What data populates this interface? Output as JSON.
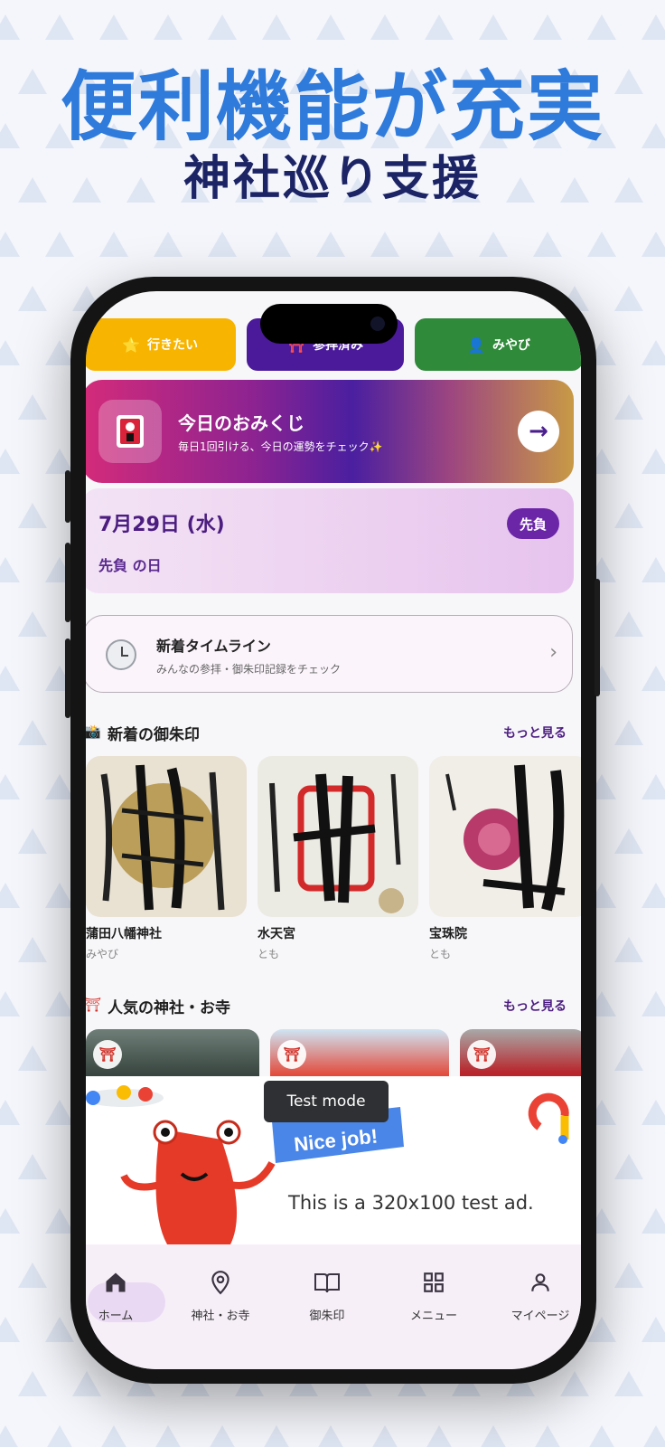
{
  "headline": "便利機能が充実",
  "subheadline": "神社巡り支援",
  "colors": {
    "brand_blue": "#2f7bdc",
    "navy": "#1c2466",
    "purple": "#4b1d80",
    "accent_purple": "#6b26a8"
  },
  "filter_chips": [
    {
      "label": "行きたい",
      "icon": "star-icon",
      "color": "#f7b400"
    },
    {
      "label": "参拝済み",
      "icon": "torii-icon",
      "color": "#4a1a9a"
    },
    {
      "label": "みやび",
      "icon": "user-icon",
      "color": "#2f8a3a"
    }
  ],
  "omikuji": {
    "title": "今日のおみくじ",
    "subtitle": "毎日1回引ける、今日の運勢をチェック✨",
    "icon": "omikuji-icon",
    "action_icon": "arrow-right-icon"
  },
  "today": {
    "date": "7月29日 (水)",
    "rokuyo_badge": "先負",
    "rokuyo_text": "先負 の日"
  },
  "timeline": {
    "title": "新着タイムライン",
    "subtitle": "みんなの参拝・御朱印記録をチェック",
    "icon": "clock-icon"
  },
  "new_stamps": {
    "title": "新着の御朱印",
    "more": "もっと見る",
    "items": [
      {
        "name": "蒲田八幡神社",
        "user": "みやび"
      },
      {
        "name": "水天宮",
        "user": "とも"
      },
      {
        "name": "宝珠院",
        "user": "とも"
      }
    ]
  },
  "popular": {
    "title": "人気の神社・お寺",
    "more": "もっと見る"
  },
  "ad": {
    "test_mode": "Test mode",
    "banner_text": "Nice job!",
    "body": "This is a 320x100 test ad."
  },
  "nav": [
    {
      "label": "ホーム",
      "icon": "home-icon",
      "active": true
    },
    {
      "label": "神社・お寺",
      "icon": "map-pin-icon",
      "active": false
    },
    {
      "label": "御朱印",
      "icon": "book-icon",
      "active": false
    },
    {
      "label": "メニュー",
      "icon": "grid-icon",
      "active": false
    },
    {
      "label": "マイページ",
      "icon": "person-icon",
      "active": false
    }
  ]
}
